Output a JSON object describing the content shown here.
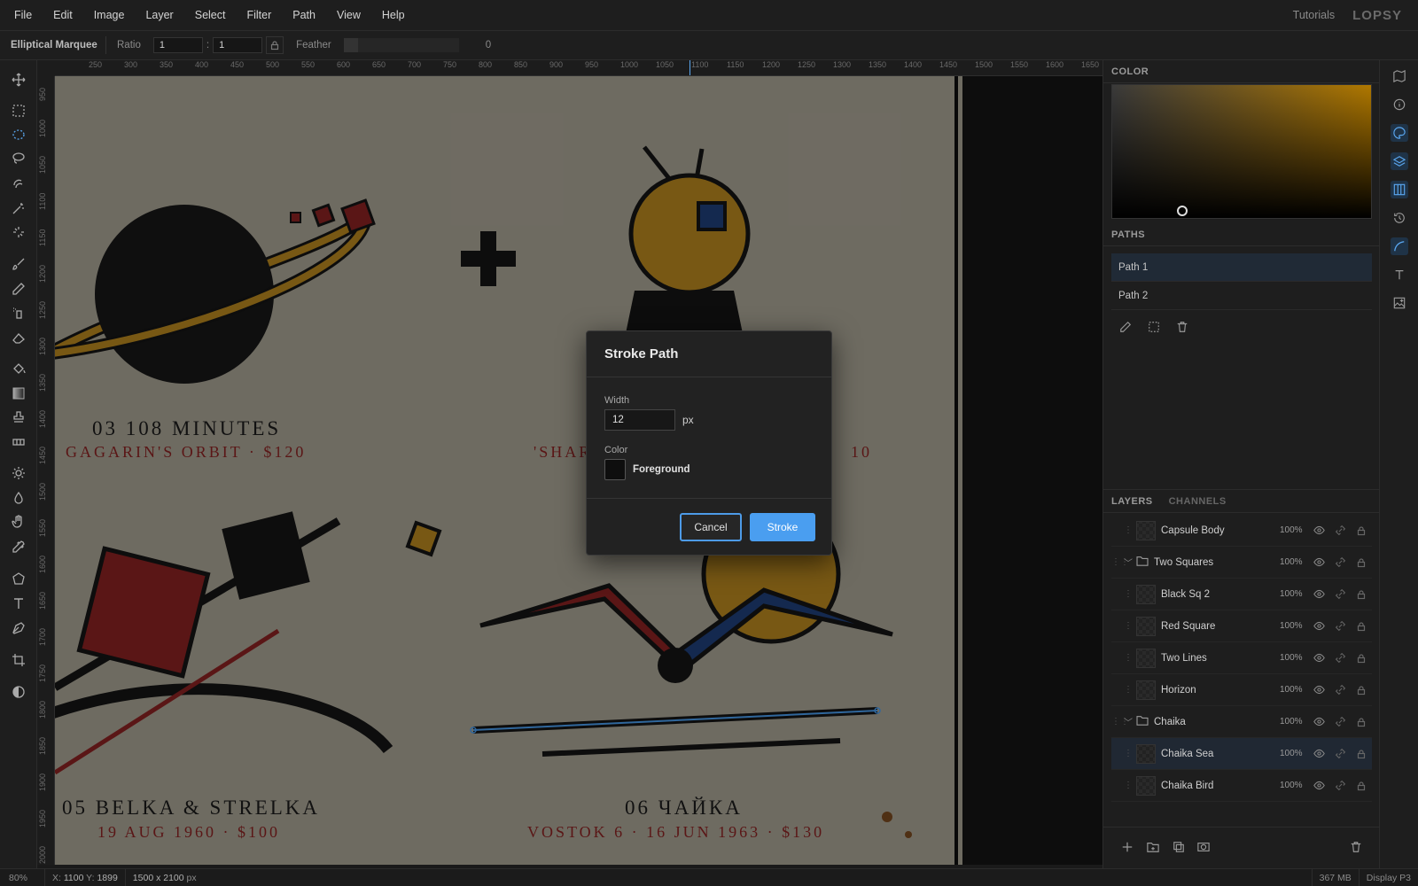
{
  "menu": [
    "File",
    "Edit",
    "Image",
    "Layer",
    "Select",
    "Filter",
    "Path",
    "View",
    "Help"
  ],
  "topbar": {
    "tutorials": "Tutorials",
    "logo": "LOPSY"
  },
  "options": {
    "tool_name": "Elliptical Marquee",
    "ratio_label": "Ratio",
    "ratio_a": "1",
    "ratio_sep": ":",
    "ratio_b": "1",
    "feather_label": "Feather",
    "feather_value": "0"
  },
  "ruler_top": [
    "250",
    "300",
    "350",
    "400",
    "450",
    "500",
    "550",
    "600",
    "650",
    "700",
    "750",
    "800",
    "850",
    "900",
    "950",
    "1000",
    "1050",
    "1100",
    "1150",
    "1200",
    "1250",
    "1300",
    "1350",
    "1400",
    "1450",
    "1500",
    "1550",
    "1600",
    "1650"
  ],
  "ruler_left": [
    "950",
    "1000",
    "1050",
    "1100",
    "1150",
    "1200",
    "1250",
    "1300",
    "1350",
    "1400",
    "1450",
    "1500",
    "1550",
    "1600",
    "1650",
    "1700",
    "1750",
    "1800",
    "1850",
    "1900",
    "1950",
    "2000"
  ],
  "poster": {
    "t03_title": "03  108 MINUTES",
    "t03_sub": "GAGARIN'S ORBIT  ·  $120",
    "t04_sub_left": "'SHAR",
    "t04_sub_right": "10",
    "t05_title": "05  BELKA & STRELKA",
    "t05_sub": "19 AUG 1960  ·  $100",
    "t06_title": "06  ЧАЙКА",
    "t06_sub": "VOSTOK 6  ·  16 JUN 1963  ·  $130"
  },
  "panels": {
    "color_title": "COLOR",
    "paths_title": "PATHS",
    "paths": [
      "Path 1",
      "Path 2"
    ],
    "layers_tab": "LAYERS",
    "channels_tab": "CHANNELS",
    "layers": [
      {
        "name": "Capsule Body",
        "opacity": "100%",
        "type": "layer"
      },
      {
        "name": "Two Squares",
        "opacity": "100%",
        "type": "group"
      },
      {
        "name": "Black Sq 2",
        "opacity": "100%",
        "type": "layer"
      },
      {
        "name": "Red Square",
        "opacity": "100%",
        "type": "layer"
      },
      {
        "name": "Two Lines",
        "opacity": "100%",
        "type": "layer"
      },
      {
        "name": "Horizon",
        "opacity": "100%",
        "type": "layer"
      },
      {
        "name": "Chaika",
        "opacity": "100%",
        "type": "group"
      },
      {
        "name": "Chaika Sea",
        "opacity": "100%",
        "type": "layer",
        "selected": true
      },
      {
        "name": "Chaika Bird",
        "opacity": "100%",
        "type": "layer"
      }
    ]
  },
  "status": {
    "zoom": "80%",
    "x_label": "X:",
    "x": "1100",
    "y_label": "Y:",
    "y": "1899",
    "doc_w": "1500",
    "doc_x": "x",
    "doc_h": "2100",
    "doc_unit": "px",
    "memory": "367 MB",
    "profile": "Display P3"
  },
  "dialog": {
    "title": "Stroke Path",
    "width_label": "Width",
    "width_value": "12",
    "width_unit": "px",
    "color_label": "Color",
    "color_value": "Foreground",
    "cancel": "Cancel",
    "stroke": "Stroke"
  },
  "colors": {
    "accent": "#4a9ef0",
    "poster_bg": "#aaa596",
    "poster_red": "#8a2323",
    "poster_gold": "#b8871f",
    "poster_blue": "#1f3f7a"
  }
}
